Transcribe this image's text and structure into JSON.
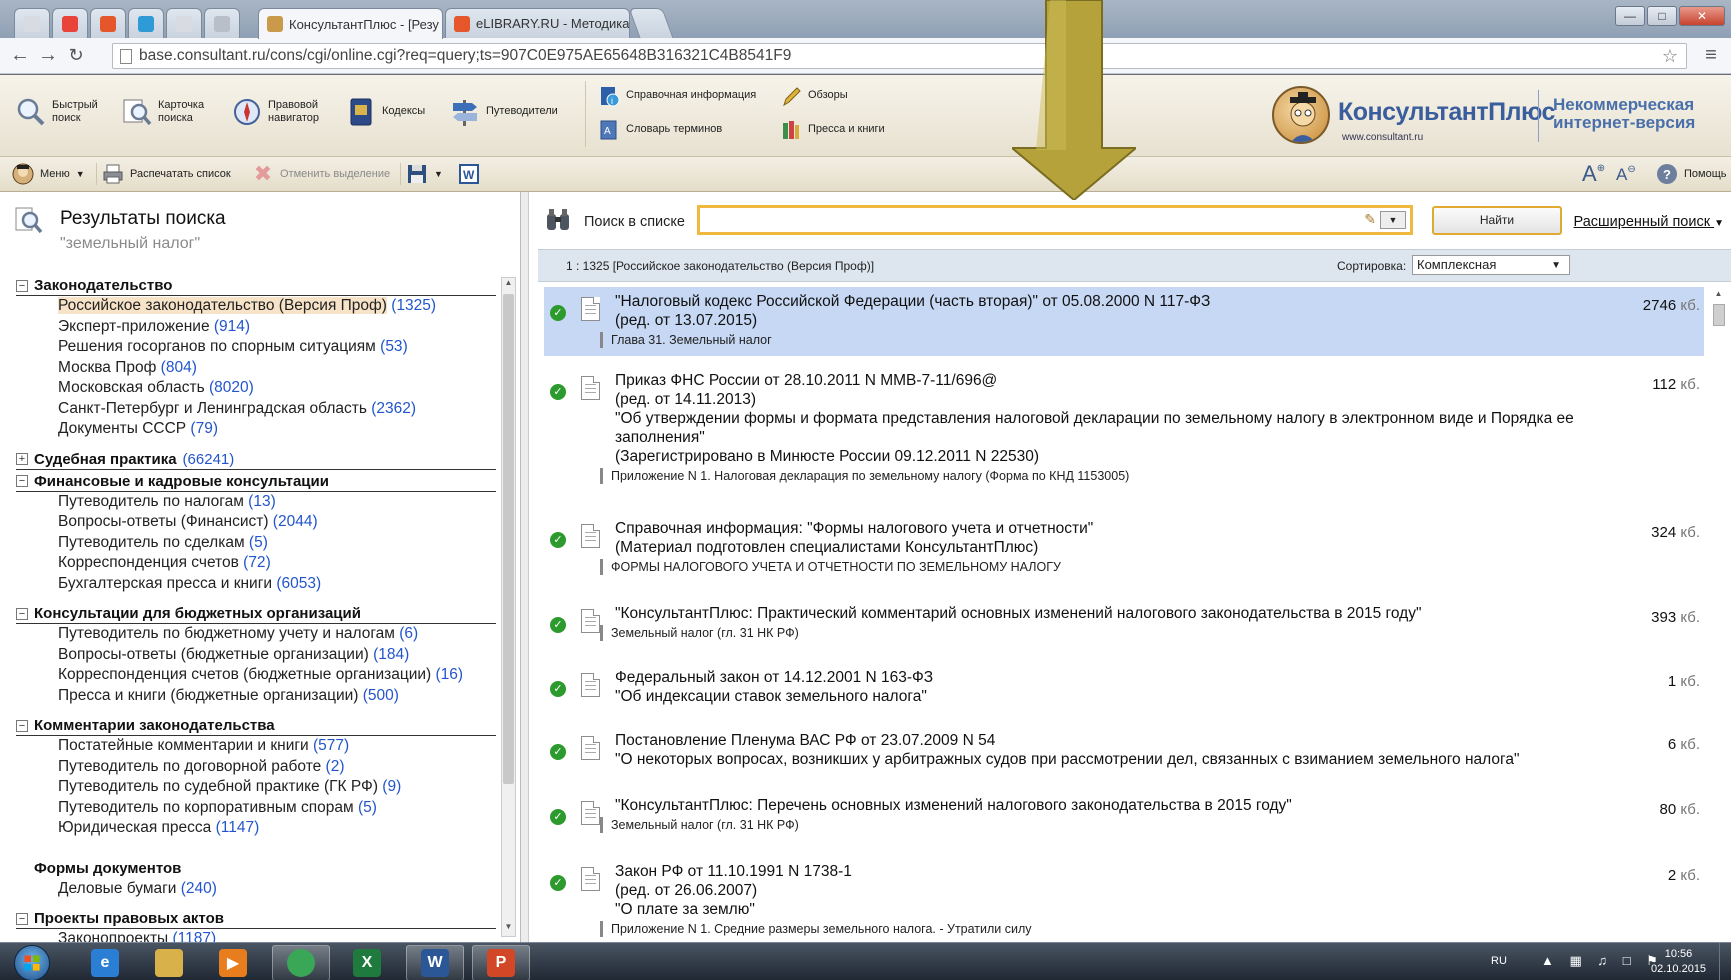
{
  "browser": {
    "tabs": [
      {
        "label": "",
        "icon": "blank-page-icon"
      },
      {
        "label": "",
        "icon": "yandex-icon"
      },
      {
        "label": "",
        "icon": "elibrary-icon"
      },
      {
        "label": "",
        "icon": "mail-icon"
      },
      {
        "label": "",
        "icon": "blank-page-icon"
      },
      {
        "label": "",
        "icon": "app-icon"
      },
      {
        "label": "КонсультантПлюс - [Резу",
        "icon": "consultant-icon",
        "active": true
      },
      {
        "label": "eLIBRARY.RU - Методика",
        "icon": "elibrary-icon"
      }
    ],
    "close_glyph": "×",
    "url": "base.consultant.ru/cons/cgi/online.cgi?req=query;ts=907C0E975AE65648B316321C4B8541F9"
  },
  "toolbar": {
    "quick_search": "Быстрый поиск",
    "card_search": "Карточка поиска",
    "legal_navigator": "Правовой навигатор",
    "codes": "Кодексы",
    "guides": "Путеводители",
    "reference_info": "Справочная информация",
    "reviews": "Обзоры",
    "term_dictionary": "Словарь терминов",
    "press_books": "Пресса и книги"
  },
  "logo": {
    "brand": "КонсультантПлюс",
    "site": "www.consultant.ru",
    "version_line1": "Некоммерческая",
    "version_line2": "интернет-версия"
  },
  "subtoolbar": {
    "menu": "Меню",
    "print_list": "Распечатать список",
    "clear_selection": "Отменить выделение",
    "help": "Помощь",
    "font_increase": "A",
    "font_decrease": "A"
  },
  "left_panel": {
    "title": "Результаты поиска",
    "query": "\"земельный налог\"",
    "groups": [
      {
        "title": "Законодательство",
        "toggle": "−",
        "items": [
          {
            "label": "Российское законодательство (Версия Проф)",
            "count": "1325",
            "selected": true
          },
          {
            "label": "Эксперт-приложение",
            "count": "914"
          },
          {
            "label": "Решения госорганов по спорным ситуациям",
            "count": "53"
          },
          {
            "label": "Москва Проф",
            "count": "804"
          },
          {
            "label": "Московская область",
            "count": "8020"
          },
          {
            "label": "Санкт-Петербург и Ленинградская область",
            "count": "2362"
          },
          {
            "label": "Документы СССР",
            "count": "79"
          }
        ]
      },
      {
        "title": "Судебная практика",
        "toggle": "+",
        "count": "66241",
        "items": []
      },
      {
        "title": "Финансовые и кадровые консультации",
        "toggle": "−",
        "items": [
          {
            "label": "Путеводитель по налогам",
            "count": "13"
          },
          {
            "label": "Вопросы-ответы (Финансист)",
            "count": "2044"
          },
          {
            "label": "Путеводитель по сделкам",
            "count": "5"
          },
          {
            "label": "Корреспонденция счетов",
            "count": "72"
          },
          {
            "label": "Бухгалтерская пресса и книги",
            "count": "6053"
          }
        ]
      },
      {
        "title": "Консультации для бюджетных организаций",
        "toggle": "−",
        "items": [
          {
            "label": "Путеводитель по бюджетному учету и налогам",
            "count": "6"
          },
          {
            "label": "Вопросы-ответы (бюджетные организации)",
            "count": "184"
          },
          {
            "label": "Корреспонденция счетов (бюджетные организации)",
            "count": "16"
          },
          {
            "label": "Пресса и книги (бюджетные организации)",
            "count": "500"
          }
        ]
      },
      {
        "title": "Комментарии законодательства",
        "toggle": "−",
        "items": [
          {
            "label": "Постатейные комментарии и книги",
            "count": "577"
          },
          {
            "label": "Путеводитель по договорной работе",
            "count": "2"
          },
          {
            "label": "Путеводитель по судебной практике (ГК РФ)",
            "count": "9"
          },
          {
            "label": "Путеводитель по корпоративным спорам",
            "count": "5"
          },
          {
            "label": "Юридическая пресса",
            "count": "1147"
          }
        ]
      },
      {
        "title": "Формы документов",
        "toggle": "",
        "noline": true,
        "items": [
          {
            "label": "Деловые бумаги",
            "count": "240"
          }
        ]
      },
      {
        "title": "Проекты правовых актов",
        "toggle": "−",
        "items": [
          {
            "label": "Законопроекты",
            "count": "1187"
          }
        ]
      }
    ]
  },
  "search_in_list": {
    "label": "Поиск в списке",
    "value": "",
    "find_button": "Найти",
    "advanced": "Расширенный поиск"
  },
  "info_bar": {
    "counts": "1 : 1325 [Российское законодательство (Версия Проф)]",
    "sort_label": "Сортировка:",
    "sort_value": "Комплексная"
  },
  "results": [
    {
      "lines": [
        "\"Налоговый кодекс Российской Федерации (часть вторая)\" от 05.08.2000 N 117-ФЗ",
        "(ред. от 13.07.2015)"
      ],
      "sub": "Глава 31. Земельный налог",
      "size": "2746",
      "unit": "кб.",
      "selected": true
    },
    {
      "lines": [
        "Приказ ФНС России от 28.10.2011 N ММВ-7-11/696@",
        "(ред. от 14.11.2013)",
        "\"Об утверждении формы и формата представления налоговой декларации по земельному налогу в электронном виде и Порядка ее заполнения\"",
        "(Зарегистрировано в Минюсте России 09.12.2011 N 22530)"
      ],
      "sub": "Приложение N 1. Налоговая декларация по земельному налогу (Форма по КНД 1153005)",
      "size": "112",
      "unit": "кб."
    },
    {
      "lines": [
        "Справочная информация: \"Формы налогового учета и отчетности\"",
        "(Материал подготовлен специалистами КонсультантПлюс)"
      ],
      "sub": "ФОРМЫ НАЛОГОВОГО УЧЕТА И ОТЧЕТНОСТИ ПО ЗЕМЕЛЬНОМУ НАЛОГУ",
      "size": "324",
      "unit": "кб."
    },
    {
      "lines": [
        "\"КонсультантПлюс: Практический комментарий основных изменений налогового законодательства в 2015 году\""
      ],
      "sub": "Земельный налог (гл. 31 НК РФ)",
      "size": "393",
      "unit": "кб."
    },
    {
      "lines": [
        "Федеральный закон от 14.12.2001 N 163-ФЗ",
        "\"Об индексации ставок земельного налога\""
      ],
      "sub": "",
      "size": "1",
      "unit": "кб."
    },
    {
      "lines": [
        "Постановление Пленума ВАС РФ от 23.07.2009 N 54",
        "\"О некоторых вопросах, возникших у арбитражных судов при рассмотрении дел, связанных с взиманием земельного налога\""
      ],
      "sub": "",
      "size": "6",
      "unit": "кб."
    },
    {
      "lines": [
        "\"КонсультантПлюс: Перечень основных изменений налогового законодательства в 2015 году\""
      ],
      "sub": "Земельный налог (гл. 31 НК РФ)",
      "size": "80",
      "unit": "кб."
    },
    {
      "lines": [
        "Закон РФ от 11.10.1991 N 1738-1",
        "(ред. от 26.06.2007)",
        "\"О плате за землю\""
      ],
      "sub": "Приложение N 1. Средние размеры земельного налога. - Утратили силу",
      "size": "2",
      "unit": "кб."
    }
  ],
  "taskbar": {
    "apps": [
      {
        "name": "internet-explorer",
        "glyph": "e",
        "color": "#2a7fd4"
      },
      {
        "name": "file-explorer",
        "glyph": "",
        "color": "#d9b14a"
      },
      {
        "name": "media-player",
        "glyph": "▶",
        "color": "#e87d1e"
      },
      {
        "name": "chrome",
        "glyph": "",
        "color": "#3aa757",
        "on": true
      },
      {
        "name": "excel",
        "glyph": "X",
        "color": "#1f7a3e"
      },
      {
        "name": "word",
        "glyph": "W",
        "color": "#2b5797",
        "on": true
      },
      {
        "name": "powerpoint",
        "glyph": "P",
        "color": "#d24726",
        "on": true
      }
    ],
    "lang": "RU",
    "time": "10:56",
    "date": "02.10.2015"
  }
}
